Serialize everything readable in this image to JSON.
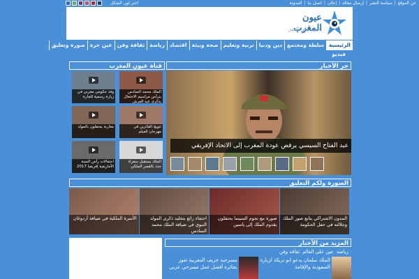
{
  "topbar": {
    "links": [
      "عن الموقع",
      "سياسة النشر",
      "إرسال مقالة",
      "إعلان",
      "اتصل بنا",
      "المدونة"
    ],
    "lang_link": "اختر لون الشكل",
    "swatch_colors": [
      "#2f6fb8",
      "#6aa56a",
      "#6b3a8a",
      "#b74d77",
      "#b52a2a",
      "#1d3d74"
    ]
  },
  "header": {
    "logo_text": "عيون المغرب",
    "logo_tagline": "عينك على الخبر"
  },
  "nav": {
    "items": [
      "الرئيسية",
      "سلطة ومجتمع",
      "دين ودنيا",
      "تربية وتعليم",
      "صحة وبيئة",
      "اقتصاد",
      "رياضة",
      "ثقافة وفن",
      "عين حرة",
      "صورة وتعليق"
    ],
    "second_row": "فيديو"
  },
  "featured": {
    "title": "جر الأخبار",
    "caption": "عبد الفتاح السيسي يرفض عودة المغرب إلى الاتحاد الإفريقي"
  },
  "video_panel": {
    "title": "قناة عيون المغرب",
    "items": [
      "الملك محمد السادس يترأس مراسيم الاحتفال بذكرى عيد العرش",
      "وفد حكومي مغربي في زيارة رسمية للجارة",
      "تتويج الفائزين في مهرجان الفيلم",
      "مغاربة يحتفلون بالمولد",
      "الملك يستقبل سفراء جدد بالقصر الملكي",
      "احتفالات رأس السنة الأمازيغية إفريقيا 2017"
    ]
  },
  "photo_panel": {
    "title": "الصورة ولكم التعليق",
    "items": [
      "المدون الاشتراكي يتابع صور الملك وجلالته في حفل الحكومة",
      "صورة مع نجوم السينما يحتفلون بقدوم الملك إلى ياسين",
      "احتفاء رائع بتخليد ذكرى المولد النبوي في ضيافة الملك محمد السادس",
      "الأسرة الملكية في ضيافة أردوغان"
    ]
  },
  "more_news": {
    "title": "المزيد من الأخبار",
    "tabs": [
      "رياضة",
      "عين على العالم",
      "ثقافة وفن"
    ],
    "items": [
      "الملك سلمان يدعو ابو تريكة لزيارة السعودية والإقامة",
      "مسرحية حريف المغربية تفوز بجائزة أفضل عمل مسرحي عربي"
    ]
  }
}
